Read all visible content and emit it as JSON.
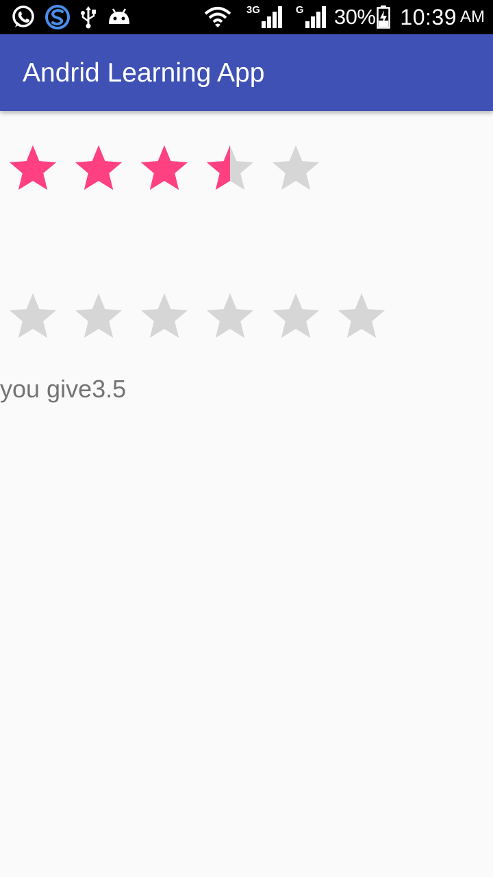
{
  "status_bar": {
    "icons_left": [
      "whatsapp-icon",
      "s-app-icon",
      "usb-icon",
      "android-debug-icon"
    ],
    "icons_right": [
      "wifi-icon",
      "signal-3g-icon",
      "signal-g-icon",
      "battery-charging-icon"
    ],
    "network_3g_label": "3G",
    "network_g_label": "G",
    "battery": "30%",
    "time": "10:39",
    "ampm": "AM"
  },
  "toolbar": {
    "title": "Andrid Learning App",
    "color": "#3F51B5"
  },
  "rating_bar_1": {
    "num_stars": 5,
    "rating": 3.5,
    "filled_color": "#FF4081",
    "empty_color": "#D6D6D6"
  },
  "rating_bar_2": {
    "num_stars": 6,
    "rating": 0,
    "filled_color": "#FF4081",
    "empty_color": "#D6D6D6"
  },
  "result_text": "you give3.5"
}
